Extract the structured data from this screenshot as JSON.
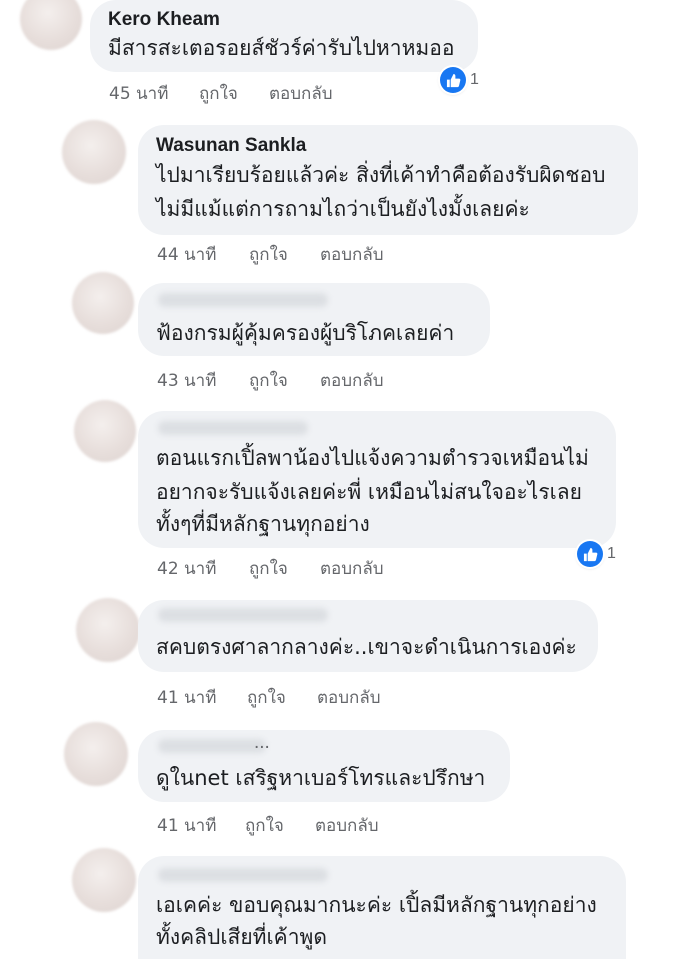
{
  "comments": [
    {
      "author": "Kero Kheam",
      "lines": [
        "มีสารสะเตอรอยส์ชัวร์ค่ารับไปหาหมออ"
      ],
      "time": "45 นาที",
      "like": "ถูกใจ",
      "reply": "ตอบกลับ",
      "reaction_count": "1"
    },
    {
      "author": "Wasunan Sankla",
      "lines": [
        "ไปมาเรียบร้อยแล้วค่ะ สิ่งที่เค้าทำคือต้องรับผิดชอบ",
        "ไม่มีแม้แต่การถามไถว่าเป็นยังไงมั้งเลยค่ะ"
      ],
      "time": "44 นาที",
      "like": "ถูกใจ",
      "reply": "ตอบกลับ"
    },
    {
      "author": "",
      "lines": [
        "ฟ้องกรมผู้คุ้มครองผู้บริโภคเลยค่า"
      ],
      "time": "43 นาที",
      "like": "ถูกใจ",
      "reply": "ตอบกลับ"
    },
    {
      "author": "",
      "lines": [
        "ตอนแรกเปิ้ลพาน้องไปแจ้งความตำรวจเหมือนไม่",
        "อยากจะรับแจ้งเลยค่ะพี่ เหมือนไม่สนใจอะไรเลย",
        "ทั้งๆที่มีหลักฐานทุกอย่าง"
      ],
      "time": "42 นาที",
      "like": "ถูกใจ",
      "reply": "ตอบกลับ",
      "reaction_count": "1"
    },
    {
      "author": "",
      "lines": [
        "สคบตรงศาลากลางค่ะ..เขาจะดำเนินการเองค่ะ"
      ],
      "time": "41 นาที",
      "like": "ถูกใจ",
      "reply": "ตอบกลับ"
    },
    {
      "author": "...",
      "lines": [
        "ดูในnet เสริฐหาเบอร์โทรและปรึกษา"
      ],
      "time": "41 นาที",
      "like": "ถูกใจ",
      "reply": "ตอบกลับ"
    },
    {
      "author": "",
      "lines": [
        "เอเคค่ะ ขอบคุณมากนะค่ะ เปิ้ลมีหลักฐานทุกอย่าง",
        "ทั้งคลิปเสียที่เค้าพูด"
      ]
    }
  ],
  "colors": {
    "bubble": "#f0f2f5",
    "meta_text": "#65676b",
    "like_blue": "#1877f2"
  },
  "icons": {
    "reaction": "like-icon"
  }
}
